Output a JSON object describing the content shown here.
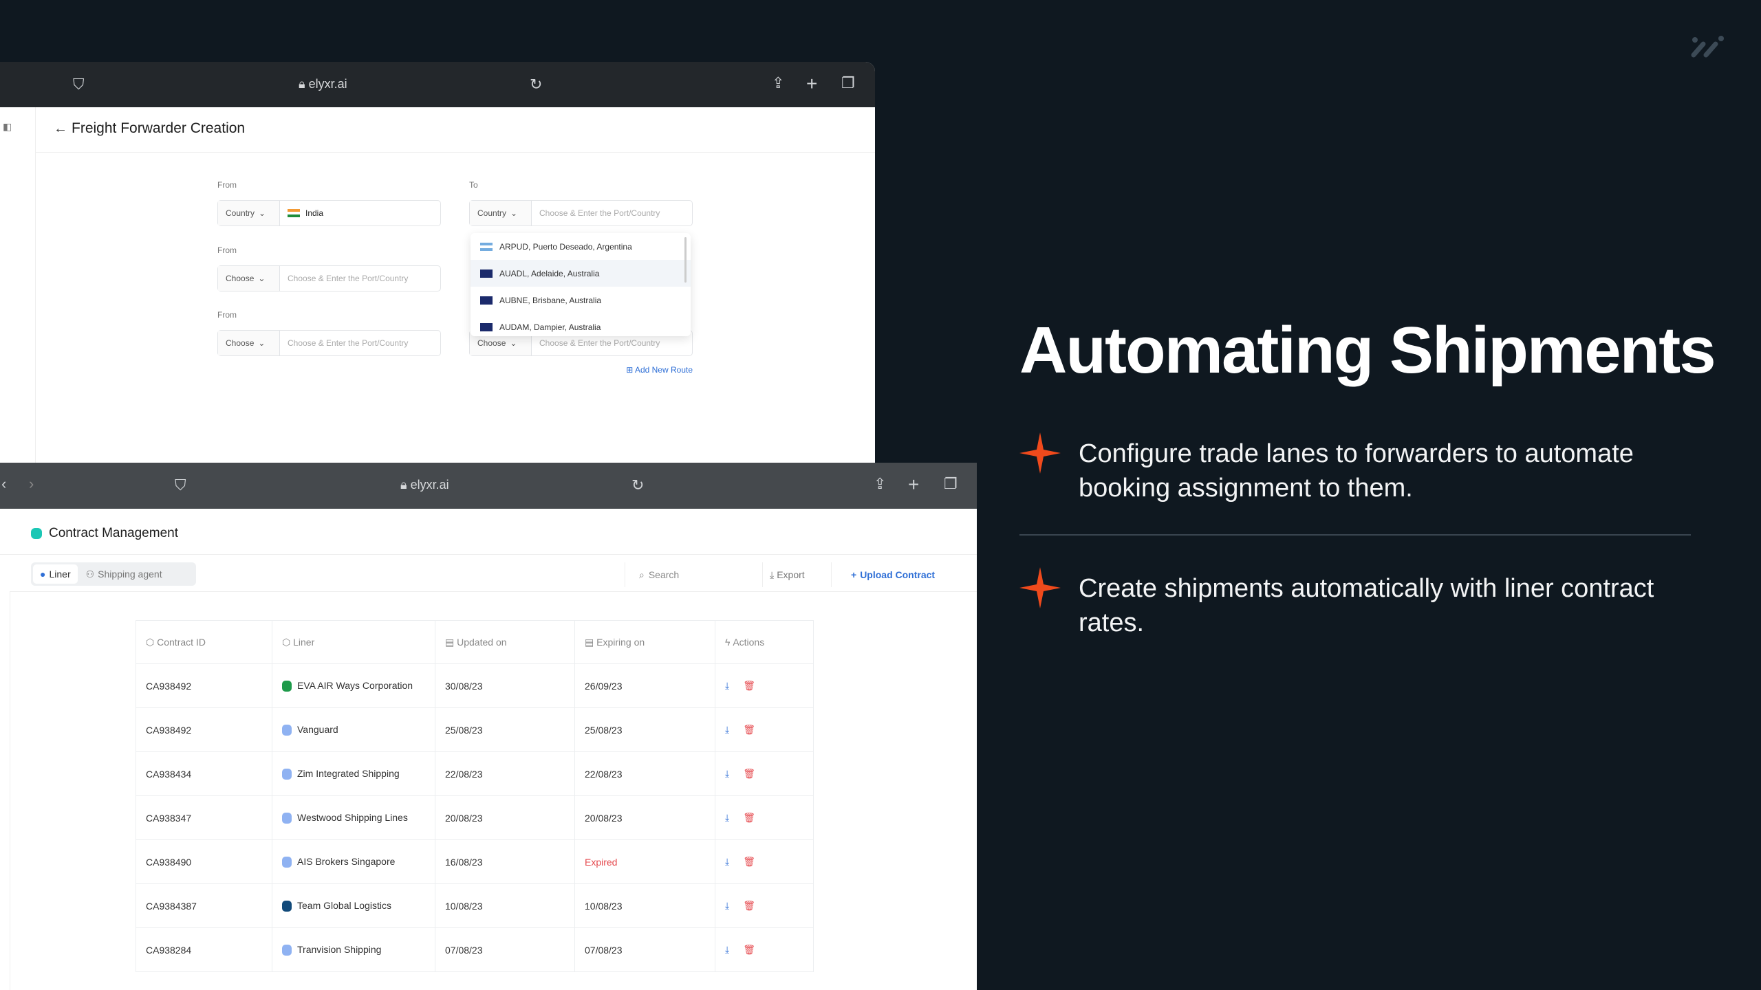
{
  "browser1": {
    "url": "elyxr.ai",
    "page_title": "Freight Forwarder Creation",
    "form": {
      "rows": [
        {
          "from_label": "From",
          "from_select": "Country",
          "from_value": "India",
          "to_label": "To",
          "to_select": "Country",
          "to_placeholder": "Choose & Enter the Port/Country"
        },
        {
          "from_label": "From",
          "from_select": "Choose",
          "from_placeholder": "Choose & Enter the Port/Country"
        },
        {
          "from_label": "From",
          "from_select": "Choose",
          "from_placeholder": "Choose & Enter the Port/Country",
          "to_select": "Choose",
          "to_placeholder": "Choose & Enter the Port/Country"
        }
      ],
      "dropdown_options": [
        {
          "label": "ARPUD, Puerto Deseado, Argentina",
          "flag": "argentina"
        },
        {
          "label": "AUADL, Adelaide, Australia",
          "flag": "australia",
          "highlighted": true
        },
        {
          "label": "AUBNE, Brisbane, Australia",
          "flag": "australia"
        },
        {
          "label": "AUDAM, Dampier, Australia",
          "flag": "australia"
        }
      ],
      "add_route": "Add New Route"
    }
  },
  "browser2": {
    "url": "elyxr.ai",
    "page_title": "Contract Management",
    "tabs": [
      {
        "label": "Liner",
        "active": true
      },
      {
        "label": "Shipping agent"
      }
    ],
    "search_placeholder": "Search",
    "export_label": "Export",
    "upload_label": "Upload Contract",
    "columns": [
      "Contract ID",
      "Liner",
      "Updated on",
      "Expiring on",
      "Actions"
    ],
    "rows": [
      {
        "id": "CA938492",
        "liner": "EVA AIR Ways Corporation",
        "updated": "30/08/23",
        "expiring": "26/09/23",
        "logo": "green"
      },
      {
        "id": "CA938492",
        "liner": "Vanguard",
        "updated": "25/08/23",
        "expiring": "25/08/23",
        "logo": "building"
      },
      {
        "id": "CA938434",
        "liner": "Zim Integrated Shipping",
        "updated": "22/08/23",
        "expiring": "22/08/23",
        "logo": "building"
      },
      {
        "id": "CA938347",
        "liner": "Westwood Shipping Lines",
        "updated": "20/08/23",
        "expiring": "20/08/23",
        "logo": "building"
      },
      {
        "id": "CA938490",
        "liner": "AIS Brokers Singapore",
        "updated": "16/08/23",
        "expiring": "Expired",
        "logo": "building"
      },
      {
        "id": "CA9384387",
        "liner": "Team Global Logistics",
        "updated": "10/08/23",
        "expiring": "10/08/23",
        "logo": "navy"
      },
      {
        "id": "CA938284",
        "liner": "Tranvision Shipping",
        "updated": "07/08/23",
        "expiring": "07/08/23",
        "logo": "building"
      }
    ]
  },
  "promo": {
    "title": "Automating Shipments",
    "bullets": [
      "Configure trade lanes to forwarders to automate booking assignment to them.",
      "Create shipments automatically with liner contract rates."
    ]
  },
  "colors": {
    "background": "#0f1820",
    "accent": "#f04a1c",
    "link": "#2f6fd6",
    "expired": "#e5484d"
  }
}
